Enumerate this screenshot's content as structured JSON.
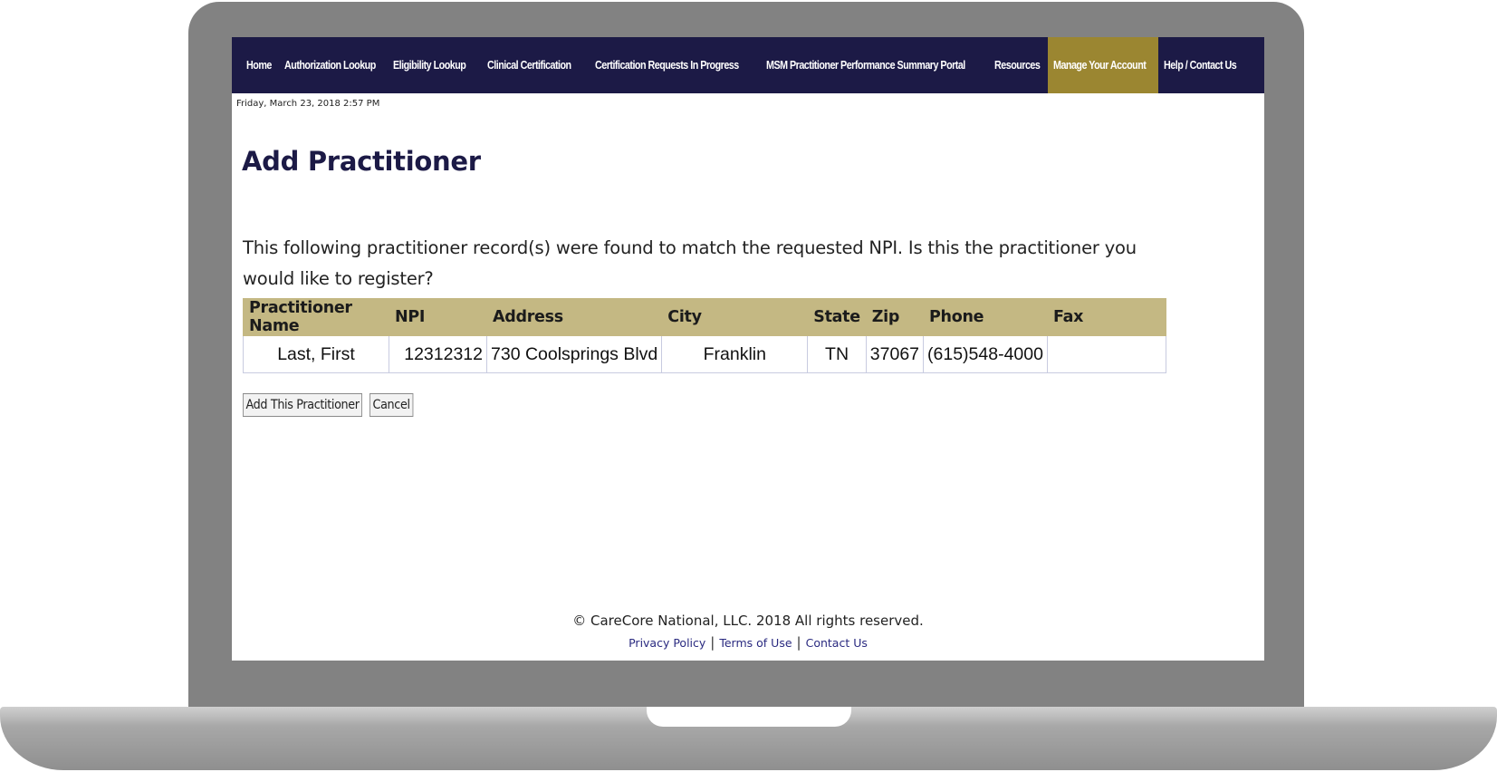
{
  "nav": {
    "items": [
      {
        "label": "Home"
      },
      {
        "label": "Authorization Lookup"
      },
      {
        "label": "Eligibility Lookup"
      },
      {
        "label": "Clinical Certification"
      },
      {
        "label": "Certification Requests In Progress"
      },
      {
        "label": "MSM Practitioner Performance Summary Portal"
      },
      {
        "label": "Resources"
      },
      {
        "label": "Manage Your Account"
      },
      {
        "label": "Help / Contact Us"
      }
    ],
    "active_color": "#9b8631",
    "bar_color": "#1c1a46"
  },
  "datestamp": "Friday, March 23, 2018 2:57 PM",
  "page_title": "Add Practitioner",
  "intro": "This following practitioner record(s) were found to match the requested NPI. Is this the practitioner you would like to register?",
  "table": {
    "headers": [
      "Practitioner Name",
      "NPI",
      "Address",
      "City",
      "State",
      "Zip",
      "Phone",
      "Fax"
    ],
    "rows": [
      [
        "Last, First",
        "12312312",
        "730 Coolsprings Blvd",
        "Franklin",
        "TN",
        "37067",
        "(615)548-4000",
        ""
      ]
    ],
    "header_color": "#c4b883"
  },
  "buttons": {
    "add": "Add This Practitioner",
    "cancel": "Cancel"
  },
  "footer": {
    "copyright": "© CareCore National, LLC. 2018 All rights reserved.",
    "links": [
      "Privacy Policy",
      "Terms of Use",
      "Contact Us"
    ],
    "separator": "|"
  }
}
